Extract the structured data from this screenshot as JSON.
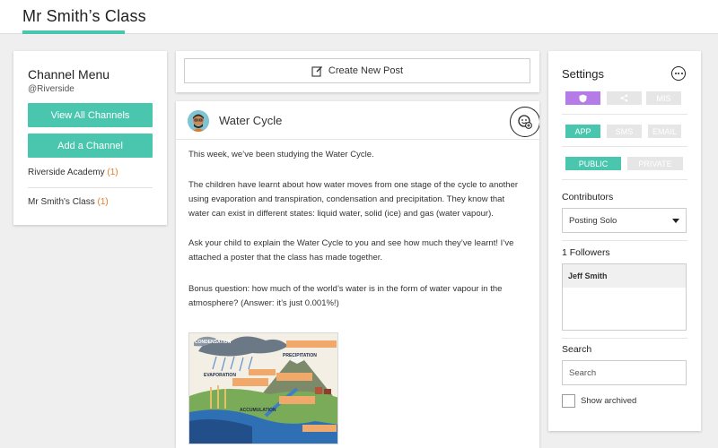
{
  "header": {
    "title": "Mr Smith’s Class",
    "accent_color": "#49c6ad"
  },
  "channel_menu": {
    "title": "Channel Menu",
    "handle": "@Riverside",
    "view_all_label": "View All Channels",
    "add_channel_label": "Add a Channel",
    "channels": [
      {
        "name": "Riverside Academy",
        "count": "(1)"
      },
      {
        "name": "Mr Smith's Class",
        "count": "(1)"
      }
    ]
  },
  "create_post": {
    "label": "Create New Post",
    "icon": "edit-icon"
  },
  "post": {
    "title": "Water Cycle",
    "paragraphs": [
      "This week, we’ve been studying the Water Cycle.",
      "The children have learnt about how water moves from one stage of the cycle to another using evaporation and transpiration, condensation and precipitation. They know that water can exist in different states: liquid water, solid (ice) and gas (water vapour).",
      "Ask your child to explain the Water Cycle to you and see how much they’ve learnt! I’ve attached a poster that the class has made together.",
      "Bonus question: how much of the world’s water is in the form of water vapour in the atmosphere? (Answer: it’s just 0.001%!)"
    ],
    "poster_labels": [
      "CONDENSATION",
      "PRECIPITATION",
      "EVAPORATION",
      "ACCUMULATION"
    ]
  },
  "settings": {
    "title": "Settings",
    "privacy_row": {
      "active_icon": "shield-icon",
      "share_icon": "share-icon",
      "mis_label": "MIS"
    },
    "delivery_row": {
      "app": "APP",
      "sms": "SMS",
      "email": "EMAIL"
    },
    "visibility_row": {
      "public": "PUBLIC",
      "private": "PRIVATE"
    },
    "contributors_label": "Contributors",
    "contributors_value": "Posting Solo",
    "followers_label": "1 Followers",
    "followers": [
      "Jeff Smith"
    ],
    "search_label": "Search",
    "search_placeholder": "Search",
    "archived_label": "Show archived",
    "colors": {
      "teal": "#49c6ad",
      "purple": "#b57be6",
      "inactive": "#e6e6e6"
    }
  }
}
